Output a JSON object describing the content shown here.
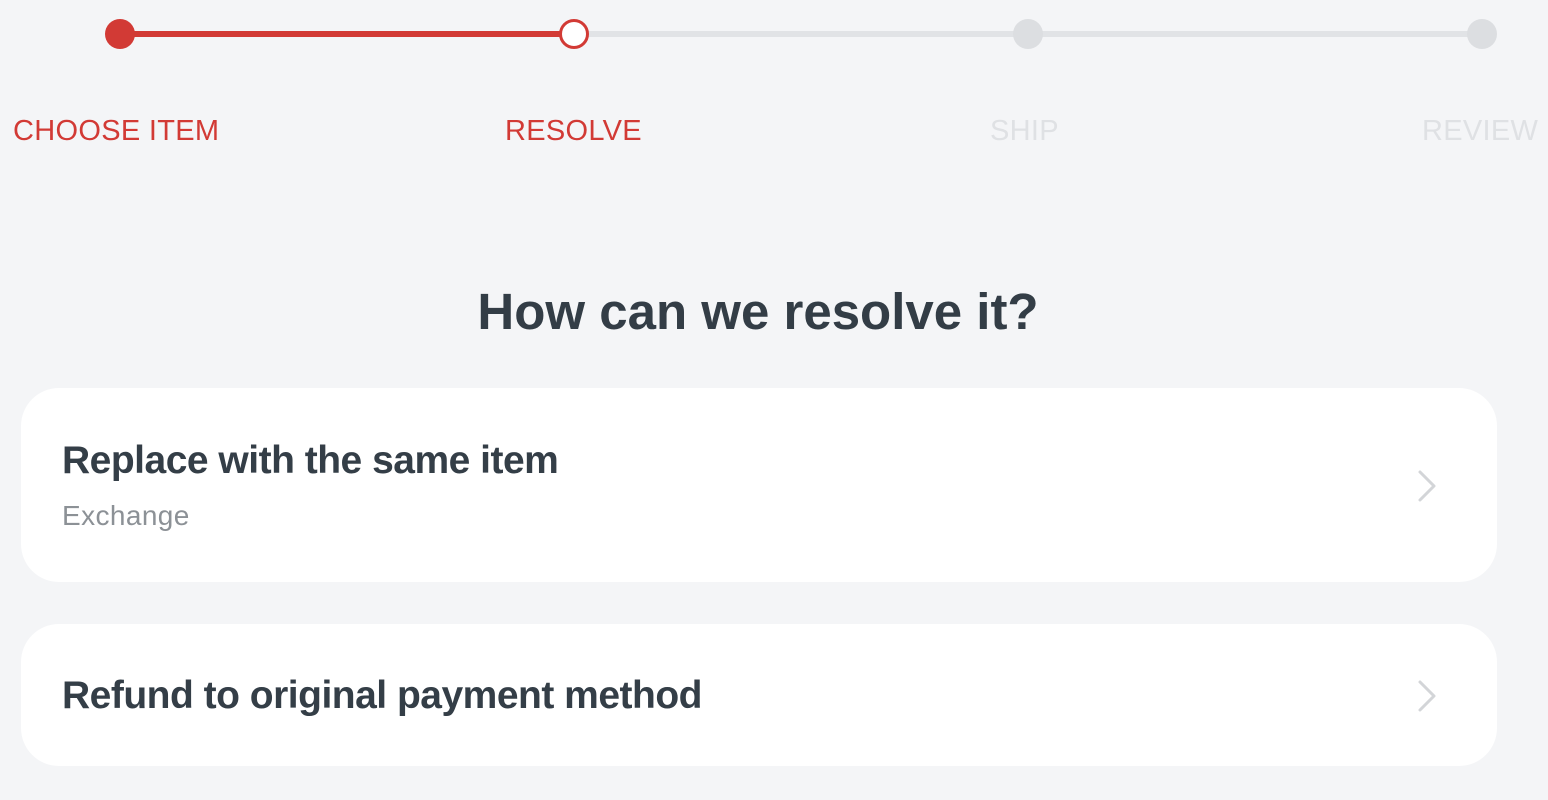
{
  "stepper": {
    "steps": [
      {
        "label": "CHOOSE ITEM",
        "state": "done"
      },
      {
        "label": "RESOLVE",
        "state": "current"
      },
      {
        "label": "SHIP",
        "state": "todo"
      },
      {
        "label": "REVIEW",
        "state": "todo"
      }
    ],
    "active_color": "#d23a35",
    "inactive_color": "#dfe1e4"
  },
  "main": {
    "heading": "How can we resolve it?",
    "options": [
      {
        "title": "Replace with the same item",
        "subtitle": "Exchange",
        "icon": "chevron-right-icon"
      },
      {
        "title": "Refund to original payment method",
        "icon": "chevron-right-icon"
      }
    ]
  }
}
